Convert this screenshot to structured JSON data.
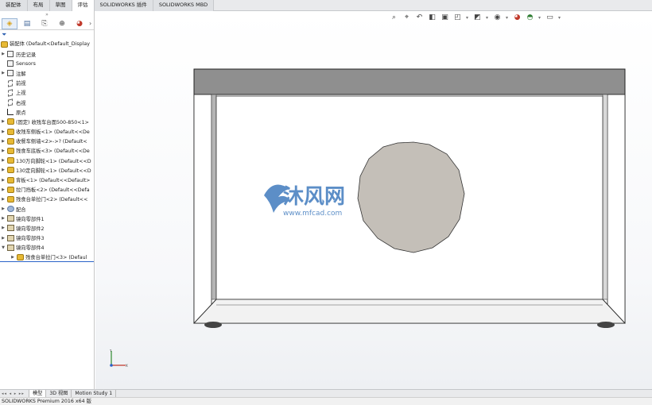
{
  "command_tabs": [
    "装配体",
    "布局",
    "草图",
    "评估",
    "SOLIDWORKS 插件",
    "SOLIDWORKS MBD"
  ],
  "active_command_tab": 3,
  "manager_tabs": [
    "feature-manager-icon",
    "property-manager-icon",
    "configuration-manager-icon",
    "dimxpert-icon",
    "display-manager-icon"
  ],
  "tree": {
    "root": "装配体  (Default<Default_Display",
    "items": [
      {
        "label": "历史记录",
        "icon": "history-icon",
        "expand": true
      },
      {
        "label": "Sensors",
        "icon": "sensors-icon",
        "expand": false
      },
      {
        "label": "注解",
        "icon": "annotations-icon",
        "expand": true
      },
      {
        "label": "前视",
        "icon": "plane-icon",
        "expand": false
      },
      {
        "label": "上视",
        "icon": "plane-icon",
        "expand": false
      },
      {
        "label": "右视",
        "icon": "plane-icon",
        "expand": false
      },
      {
        "label": "原点",
        "icon": "origin-icon",
        "expand": false
      },
      {
        "label": "(固定) 收残车台面500-850<1>",
        "icon": "part-icon",
        "expand": true
      },
      {
        "label": "收残车侧板<1> (Default<<De",
        "icon": "part-icon",
        "expand": true
      },
      {
        "label": "收餐车侧墙<2>->? (Default<",
        "icon": "part-icon",
        "expand": true
      },
      {
        "label": "残食车底板<3> (Default<<De",
        "icon": "part-icon",
        "expand": true
      },
      {
        "label": "130万向脚轮<1> (Default<<D",
        "icon": "part-icon",
        "expand": true
      },
      {
        "label": "130定向脚轮<1> (Default<<D",
        "icon": "part-icon",
        "expand": true
      },
      {
        "label": "背板<1> (Default<<Default>",
        "icon": "part-icon",
        "expand": true
      },
      {
        "label": "拉门挡板<2> (Default<<Defa",
        "icon": "part-icon",
        "expand": true
      },
      {
        "label": "残食台单拉门<2> (Default<<",
        "icon": "part-icon",
        "expand": true
      },
      {
        "label": "配合",
        "icon": "mates-icon",
        "expand": true
      },
      {
        "label": "镜向零部件1",
        "icon": "mirror-component-icon",
        "expand": true
      },
      {
        "label": "镜向零部件2",
        "icon": "mirror-component-icon",
        "expand": true
      },
      {
        "label": "镜向零部件3",
        "icon": "mirror-component-icon",
        "expand": true
      },
      {
        "label": "镜向零部件4",
        "icon": "mirror-component-icon",
        "expand": true,
        "open": true
      },
      {
        "label": "残食台单拉门<3> (Defaul",
        "icon": "part-icon",
        "expand": true,
        "child": true
      }
    ]
  },
  "watermark": {
    "text": "沐风网",
    "url": "www.mfcad.com"
  },
  "bottom_tabs": [
    "模型",
    "3D 视图",
    "Motion Study 1"
  ],
  "active_bottom_tab": 0,
  "status_text": "SOLIDWORKS Premium 2016 x64 版",
  "colors": {
    "frame_top": "#8f8f8f",
    "door": "#c4bfb8",
    "watermark": "#2f6fb8",
    "selection": "#2b63c8"
  }
}
